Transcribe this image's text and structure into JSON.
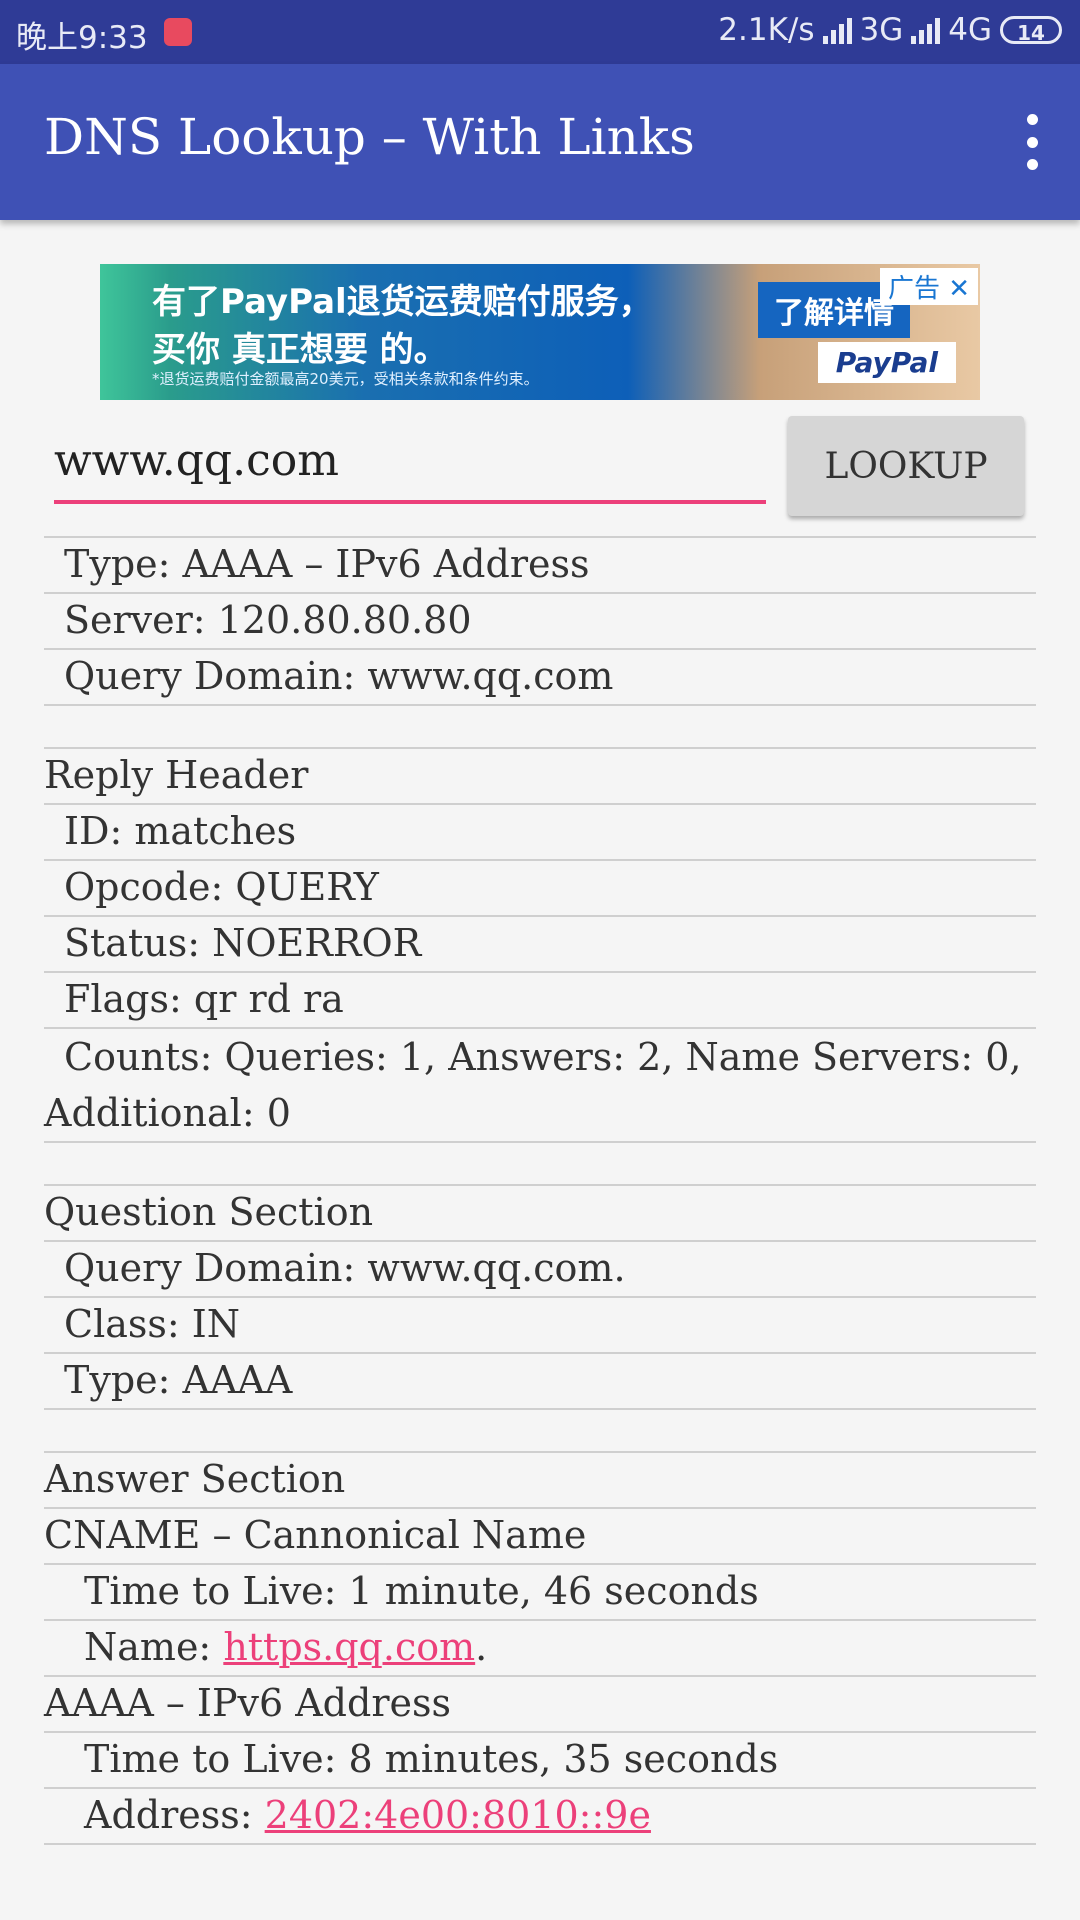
{
  "status_bar": {
    "time": "晚上9:33",
    "notification_badge": "ఊ",
    "speed": "2.1K/s",
    "net1": "3G",
    "net2": "4G",
    "battery": "14"
  },
  "app_bar": {
    "title": "DNS Lookup – With Links",
    "menu_icon": "overflow-menu-icon"
  },
  "ad": {
    "line1": "有了PayPal退货运费赔付服务，",
    "line2": "买你 真正想要 的。",
    "line3": "*退货运费赔付金额最高20美元，受相关条款和条件约束。",
    "cta": "了解详情",
    "brand": "PayPal",
    "tag": "广告 ✕"
  },
  "search": {
    "value": "www.qq.com",
    "button": "LOOKUP"
  },
  "results": {
    "type": "Type: AAAA – IPv6 Address",
    "server": "Server: 120.80.80.80",
    "query_domain": "Query Domain: www.qq.com",
    "reply_header": "Reply Header",
    "id": "ID: matches",
    "opcode": "Opcode: QUERY",
    "status": "Status: NOERROR",
    "flags": "Flags: qr rd ra",
    "counts": "Counts: Queries: 1, Answers: 2, Name Servers: 0, Additional: 0",
    "question_section": "Question Section",
    "q_domain": "Query Domain: www.qq.com.",
    "q_class": "Class: IN",
    "q_type": "Type: AAAA",
    "answer_section": "Answer Section",
    "cname_title": "CNAME – Cannonical Name",
    "cname_ttl": "Time to Live: 1 minute, 46 seconds",
    "cname_name_label": "Name: ",
    "cname_name_link": "https.qq.com",
    "cname_name_suffix": ".",
    "aaaa_title": "AAAA – IPv6 Address",
    "aaaa_ttl": "Time to Live: 8 minutes, 35 seconds",
    "aaaa_addr_label": "Address: ",
    "aaaa_addr_link": "2402:4e00:8010::9e"
  },
  "colors": {
    "app_bar": "#3f51b5",
    "status_bar": "#2f3b96",
    "accent": "#ec407a"
  }
}
